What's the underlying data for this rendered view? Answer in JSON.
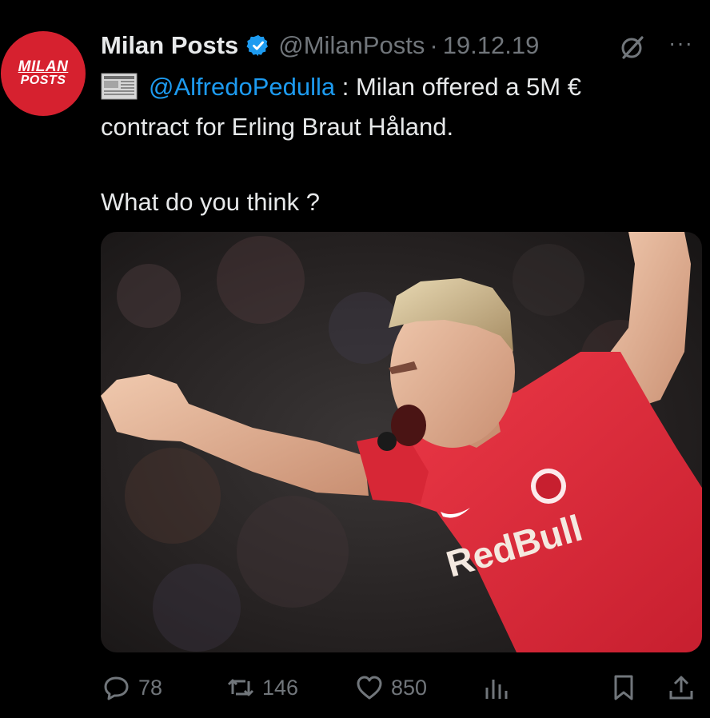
{
  "tweet": {
    "avatar": {
      "line1": "MILAN",
      "line2": "POSTS"
    },
    "author_name": "Milan Posts",
    "handle": "@MilanPosts",
    "separator": "·",
    "date": "19.12.19",
    "mention": "@AlfredoPedulla",
    "text_after_mention": " : Milan offered a 5M €",
    "text_line2": "contract for Erling Braut Håland.",
    "text_line3": "What do you think ?",
    "media": {
      "shirt_text": "RedBull"
    }
  },
  "actions": {
    "replies": "78",
    "reposts": "146",
    "likes": "850"
  },
  "colors": {
    "background": "#000000",
    "text": "#e7e9ea",
    "secondary": "#71767b",
    "link": "#1d9bf0",
    "avatar": "#d6212f",
    "jersey": "#e02d3c"
  },
  "icons": [
    "verified-badge-icon",
    "grok-icon",
    "more-icon",
    "newspaper-icon",
    "reply-icon",
    "repost-icon",
    "like-icon",
    "views-icon",
    "bookmark-icon",
    "share-icon"
  ]
}
